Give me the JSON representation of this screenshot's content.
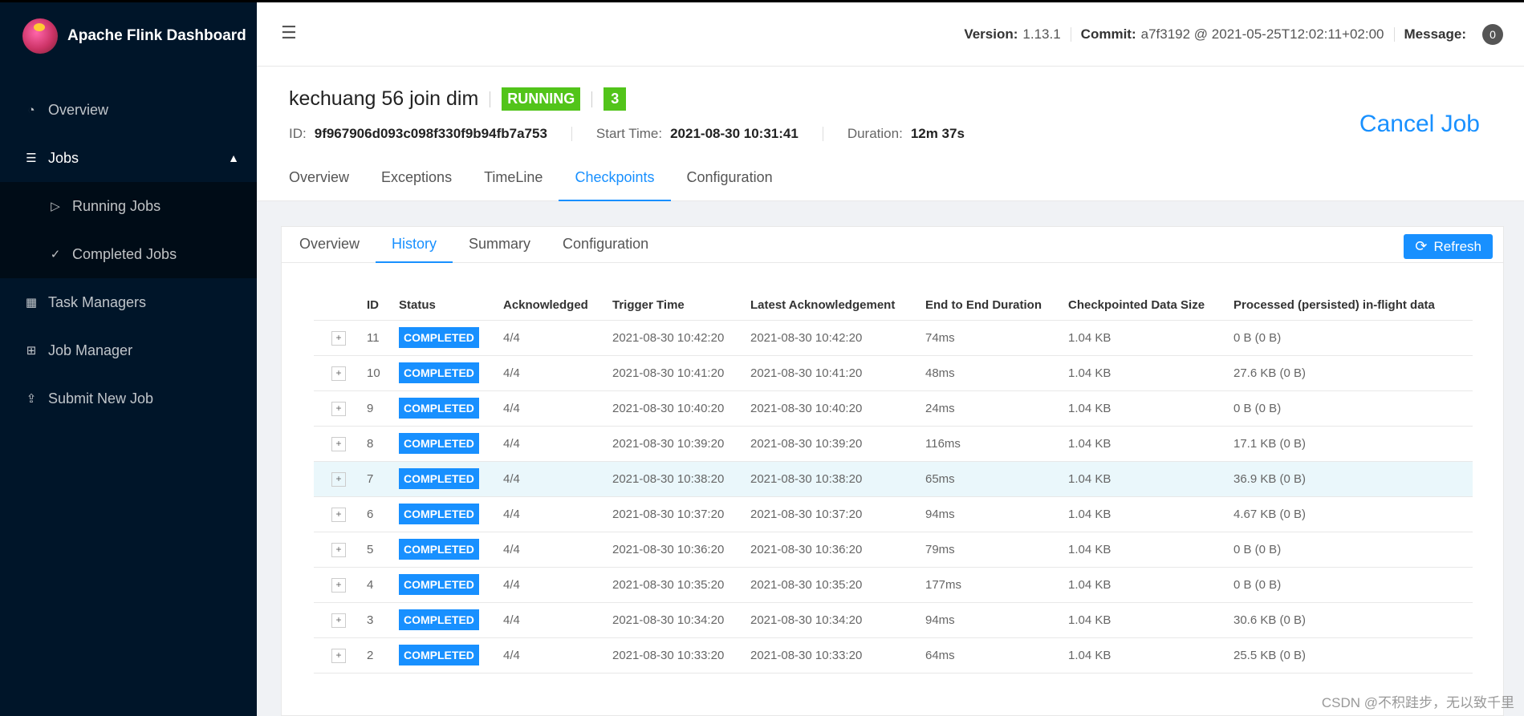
{
  "app": {
    "title": "Apache Flink Dashboard"
  },
  "sidebar": {
    "items": [
      {
        "label": "Overview",
        "icon": "dashboard-icon"
      },
      {
        "label": "Jobs",
        "icon": "list-icon"
      },
      {
        "label": "Running Jobs",
        "icon": "play-circle-icon"
      },
      {
        "label": "Completed Jobs",
        "icon": "check-circle-icon"
      },
      {
        "label": "Task Managers",
        "icon": "schedule-icon"
      },
      {
        "label": "Job Manager",
        "icon": "cluster-icon"
      },
      {
        "label": "Submit New Job",
        "icon": "upload-icon"
      }
    ]
  },
  "header": {
    "version_label": "Version:",
    "version": "1.13.1",
    "commit_label": "Commit:",
    "commit": "a7f3192 @ 2021-05-25T12:02:11+02:00",
    "message_label": "Message:",
    "message_count": "0"
  },
  "job": {
    "name": "kechuang 56 join dim",
    "state": "RUNNING",
    "count": "3",
    "id_label": "ID:",
    "id": "9f967906d093c098f330f9b94fb7a753",
    "start_label": "Start Time:",
    "start_time": "2021-08-30 10:31:41",
    "duration_label": "Duration:",
    "duration": "12m 37s",
    "cancel_label": "Cancel Job",
    "tabs": [
      "Overview",
      "Exceptions",
      "TimeLine",
      "Checkpoints",
      "Configuration"
    ],
    "active_tab": "Checkpoints"
  },
  "checkpoints": {
    "tabs": [
      "Overview",
      "History",
      "Summary",
      "Configuration"
    ],
    "active_tab": "History",
    "refresh_label": "Refresh",
    "columns": [
      "ID",
      "Status",
      "Acknowledged",
      "Trigger Time",
      "Latest Acknowledgement",
      "End to End Duration",
      "Checkpointed Data Size",
      "Processed (persisted) in-flight data"
    ],
    "rows": [
      {
        "expand": "+",
        "id": "11",
        "status": "COMPLETED",
        "ack": "4/4",
        "trigger": "2021-08-30 10:42:20",
        "latest": "2021-08-30 10:42:20",
        "duration": "74ms",
        "size": "1.04 KB",
        "inflight": "0 B (0 B)"
      },
      {
        "expand": "+",
        "id": "10",
        "status": "COMPLETED",
        "ack": "4/4",
        "trigger": "2021-08-30 10:41:20",
        "latest": "2021-08-30 10:41:20",
        "duration": "48ms",
        "size": "1.04 KB",
        "inflight": "27.6 KB (0 B)"
      },
      {
        "expand": "+",
        "id": "9",
        "status": "COMPLETED",
        "ack": "4/4",
        "trigger": "2021-08-30 10:40:20",
        "latest": "2021-08-30 10:40:20",
        "duration": "24ms",
        "size": "1.04 KB",
        "inflight": "0 B (0 B)"
      },
      {
        "expand": "+",
        "id": "8",
        "status": "COMPLETED",
        "ack": "4/4",
        "trigger": "2021-08-30 10:39:20",
        "latest": "2021-08-30 10:39:20",
        "duration": "116ms",
        "size": "1.04 KB",
        "inflight": "17.1 KB (0 B)"
      },
      {
        "expand": "+",
        "id": "7",
        "status": "COMPLETED",
        "ack": "4/4",
        "trigger": "2021-08-30 10:38:20",
        "latest": "2021-08-30 10:38:20",
        "duration": "65ms",
        "size": "1.04 KB",
        "inflight": "36.9 KB (0 B)"
      },
      {
        "expand": "+",
        "id": "6",
        "status": "COMPLETED",
        "ack": "4/4",
        "trigger": "2021-08-30 10:37:20",
        "latest": "2021-08-30 10:37:20",
        "duration": "94ms",
        "size": "1.04 KB",
        "inflight": "4.67 KB (0 B)"
      },
      {
        "expand": "+",
        "id": "5",
        "status": "COMPLETED",
        "ack": "4/4",
        "trigger": "2021-08-30 10:36:20",
        "latest": "2021-08-30 10:36:20",
        "duration": "79ms",
        "size": "1.04 KB",
        "inflight": "0 B (0 B)"
      },
      {
        "expand": "+",
        "id": "4",
        "status": "COMPLETED",
        "ack": "4/4",
        "trigger": "2021-08-30 10:35:20",
        "latest": "2021-08-30 10:35:20",
        "duration": "177ms",
        "size": "1.04 KB",
        "inflight": "0 B (0 B)"
      },
      {
        "expand": "+",
        "id": "3",
        "status": "COMPLETED",
        "ack": "4/4",
        "trigger": "2021-08-30 10:34:20",
        "latest": "2021-08-30 10:34:20",
        "duration": "94ms",
        "size": "1.04 KB",
        "inflight": "30.6 KB (0 B)"
      },
      {
        "expand": "+",
        "id": "2",
        "status": "COMPLETED",
        "ack": "4/4",
        "trigger": "2021-08-30 10:33:20",
        "latest": "2021-08-30 10:33:20",
        "duration": "64ms",
        "size": "1.04 KB",
        "inflight": "25.5 KB (0 B)"
      }
    ]
  },
  "watermark": "CSDN @不积跬步，无以致千里",
  "colors": {
    "sidebar_bg": "#001529",
    "accent": "#1890ff",
    "running": "#52c41a"
  }
}
